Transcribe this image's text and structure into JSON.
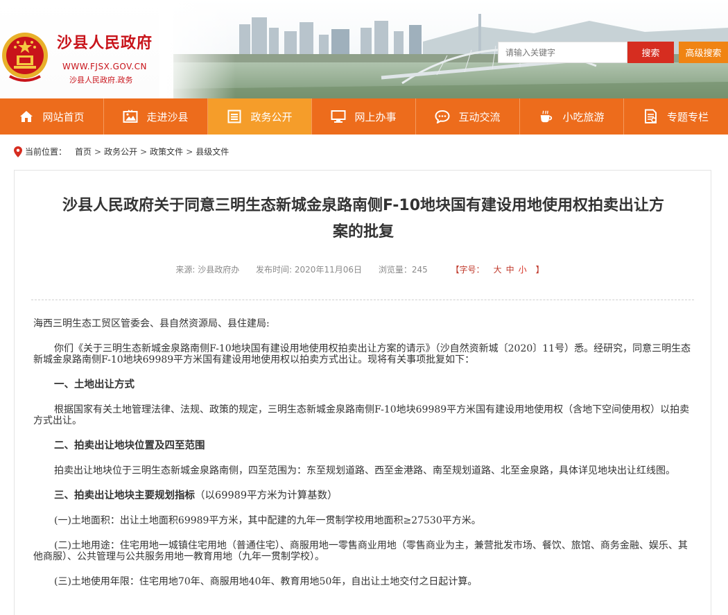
{
  "colors": {
    "brand_red": "#c8131a",
    "nav_orange": "#ed6c1c",
    "nav_active": "#f59d2a",
    "search_red": "#d62d20",
    "adv_orange": "#f08413"
  },
  "header": {
    "title": "沙县人民政府",
    "url": "WWW.FJSX.GOV.CN",
    "subtitle": "沙县人民政府.政务",
    "search": {
      "placeholder": "请输入关键字",
      "button": "搜索",
      "advanced": "高级搜索"
    }
  },
  "nav": {
    "items": [
      {
        "label": "网站首页",
        "icon": "home-icon"
      },
      {
        "label": "走进沙县",
        "icon": "picture-icon"
      },
      {
        "label": "政务公开",
        "icon": "list-icon"
      },
      {
        "label": "网上办事",
        "icon": "monitor-icon"
      },
      {
        "label": "互动交流",
        "icon": "chat-icon"
      },
      {
        "label": "小吃旅游",
        "icon": "coffee-cup-icon"
      },
      {
        "label": "专题专栏",
        "icon": "document-icon"
      }
    ]
  },
  "breadcrumb": {
    "prefix": "当前位置：",
    "items": [
      "首页",
      "政务公开",
      "政策文件",
      "县级文件"
    ],
    "sep": ">"
  },
  "article": {
    "title_line1": "沙县人民政府关于同意三明生态新城金泉路南侧F-10地块国有建设用地使用权拍卖出让方",
    "title_line2": "案的批复",
    "meta": {
      "source": "来源: 沙县政府办",
      "date": "发布时间: 2020年11月06日",
      "views": "浏览量：245",
      "font_label": "【字号：",
      "font_large": "大",
      "font_medium": "中",
      "font_small": "小",
      "font_close": "】"
    },
    "paragraphs": {
      "salutation": "海西三明生态工贸区管委会、县自然资源局、县住建局:",
      "p1": "你们《关于三明生态新城金泉路南侧F-10地块国有建设用地使用权拍卖出让方案的请示》（沙自然资新城〔2020〕11号）悉。经研究，同意三明生态新城金泉路南侧F-10地块69989平方米国有建设用地使用权以拍卖方式出让。现将有关事项批复如下：",
      "h1": "一、土地出让方式",
      "p2": "根据国家有关土地管理法律、法规、政策的规定，三明生态新城金泉路南侧F-10地块69989平方米国有建设用地使用权（含地下空间使用权）以拍卖方式出让。",
      "h2": "二、拍卖出让地块位置及四至范围",
      "p3": "拍卖出让地块位于三明生态新城金泉路南侧，四至范围为：东至规划道路、西至金港路、南至规划道路、北至金泉路，具体详见地块出让红线图。",
      "h3": "三、拍卖出让地块主要规划指标",
      "h3_note": "（以69989平方米为计算基数）",
      "p4": "(一)土地面积：出让土地面积69989平方米，其中配建的九年一贯制学校用地面积≥27530平方米。",
      "p5": "(二)土地用途：住宅用地一城镇住宅用地（普通住宅）、商服用地一零售商业用地（零售商业为主，兼营批发市场、餐饮、旅馆、商务金融、娱乐、其他商服）、公共管理与公共服务用地一教育用地（九年一贯制学校）。",
      "p6": "(三)土地使用年限：住宅用地70年、商服用地40年、教育用地50年，自出让土地交付之日起计算。"
    }
  }
}
